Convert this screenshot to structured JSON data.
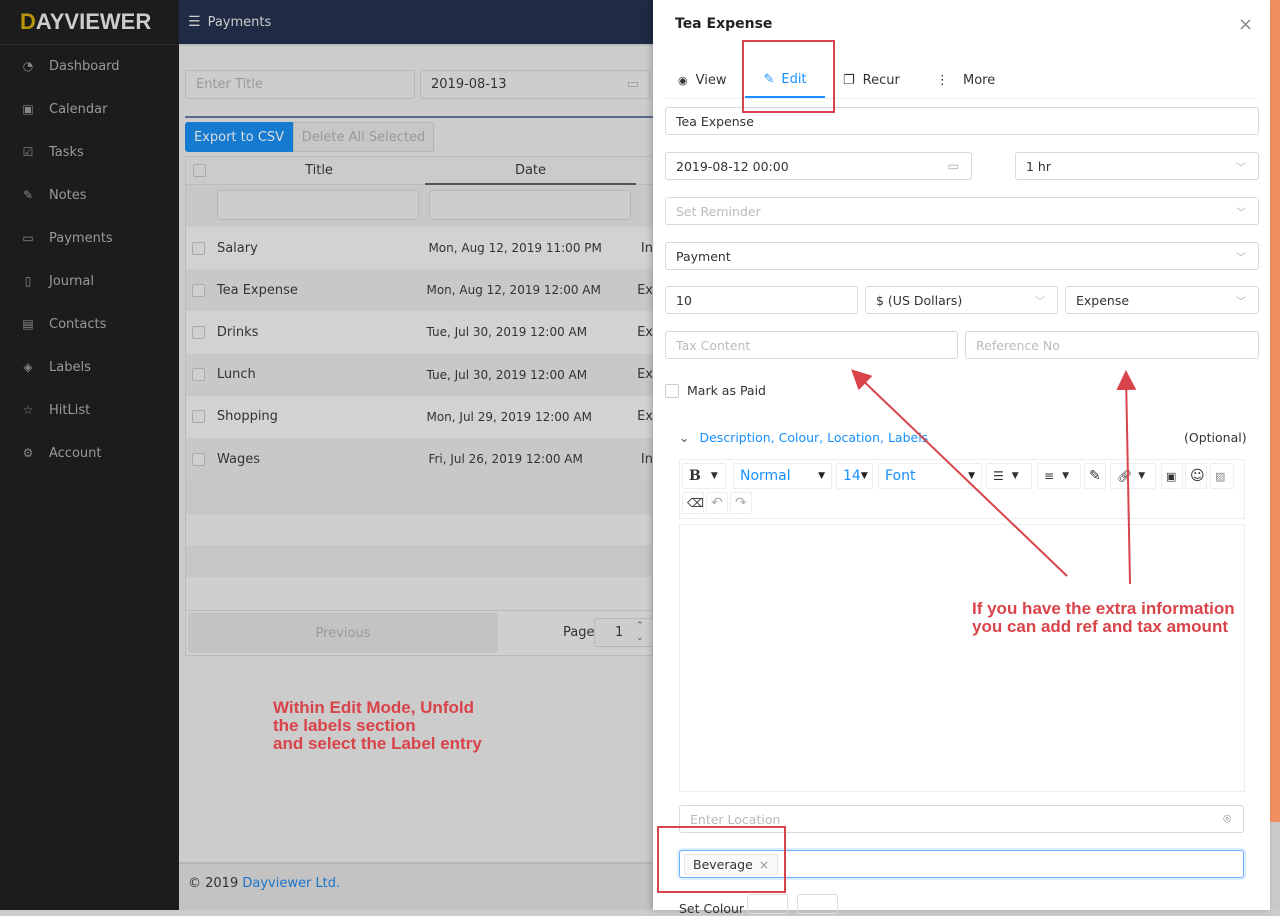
{
  "brand": {
    "logo_first": "D",
    "logo_rest": "AYVIEWER"
  },
  "sidebar": {
    "items": [
      {
        "label": "Dashboard",
        "icon": "dashboard-icon",
        "glyph": "◔"
      },
      {
        "label": "Calendar",
        "icon": "calendar-icon",
        "glyph": "▣"
      },
      {
        "label": "Tasks",
        "icon": "checkbox-icon",
        "glyph": "☑"
      },
      {
        "label": "Notes",
        "icon": "pin-icon",
        "glyph": "✎"
      },
      {
        "label": "Payments",
        "icon": "wallet-icon",
        "glyph": "▭"
      },
      {
        "label": "Journal",
        "icon": "book-icon",
        "glyph": "▯"
      },
      {
        "label": "Contacts",
        "icon": "contacts-icon",
        "glyph": "▤"
      },
      {
        "label": "Labels",
        "icon": "tag-icon",
        "glyph": "◈"
      },
      {
        "label": "HitList",
        "icon": "star-icon",
        "glyph": "☆"
      },
      {
        "label": "Account",
        "icon": "gear-icon",
        "glyph": "⚙"
      }
    ]
  },
  "header": {
    "title": "Payments"
  },
  "filters": {
    "title_placeholder": "Enter Title",
    "date": "2019-08-13"
  },
  "toolbar": {
    "export": "Export to CSV",
    "delete_all": "Delete All Selected"
  },
  "table": {
    "columns": [
      "Title",
      "Date"
    ],
    "rows": [
      {
        "title": "Salary",
        "date": "Mon, Aug 12, 2019 11:00 PM",
        "type": "In"
      },
      {
        "title": "Tea Expense",
        "date": "Mon, Aug 12, 2019 12:00 AM",
        "type": "Ex"
      },
      {
        "title": "Drinks",
        "date": "Tue, Jul 30, 2019 12:00 AM",
        "type": "Ex"
      },
      {
        "title": "Lunch",
        "date": "Tue, Jul 30, 2019 12:00 AM",
        "type": "Ex"
      },
      {
        "title": "Shopping",
        "date": "Mon, Jul 29, 2019 12:00 AM",
        "type": "Ex"
      },
      {
        "title": "Wages",
        "date": "Fri, Jul 26, 2019 12:00 AM",
        "type": "In"
      }
    ]
  },
  "pagination": {
    "previous": "Previous",
    "page_label": "Page",
    "page": "1"
  },
  "footer": {
    "copyright": "© 2019 ",
    "company": "Dayviewer Ltd."
  },
  "annotations": {
    "left_line1": "Within Edit Mode, Unfold",
    "left_line2": "the labels section",
    "left_line3": "and select the Label entry",
    "right_line1": "If you have the extra information",
    "right_line2": "you can add ref and tax amount",
    "color": "#d9434a"
  },
  "panel": {
    "title": "Tea Expense",
    "tabs": [
      {
        "label": "View",
        "glyph": "👁"
      },
      {
        "label": "Edit",
        "glyph": "✎"
      },
      {
        "label": "Recur",
        "glyph": "❐"
      },
      {
        "label": "More",
        "glyph": "⋮"
      }
    ],
    "active_tab": "Edit",
    "title_value": "Tea Expense",
    "datetime": "2019-08-12 00:00",
    "duration": "1 hr",
    "reminder_placeholder": "Set Reminder",
    "category": "Payment",
    "amount": "10",
    "currency": "$ (US Dollars)",
    "type": "Expense",
    "tax_placeholder": "Tax Content",
    "ref_placeholder": "Reference No",
    "mark_paid": "Mark as Paid",
    "section_label": "Description, Colour, Location, Labels",
    "optional": "(Optional)",
    "editor": {
      "bold": "B",
      "style": "Normal",
      "size": "14",
      "font": "Font"
    },
    "location_placeholder": "Enter Location",
    "label_tag": "Beverage",
    "set_colour": "Set Colour",
    "accent": "#1890ff"
  }
}
